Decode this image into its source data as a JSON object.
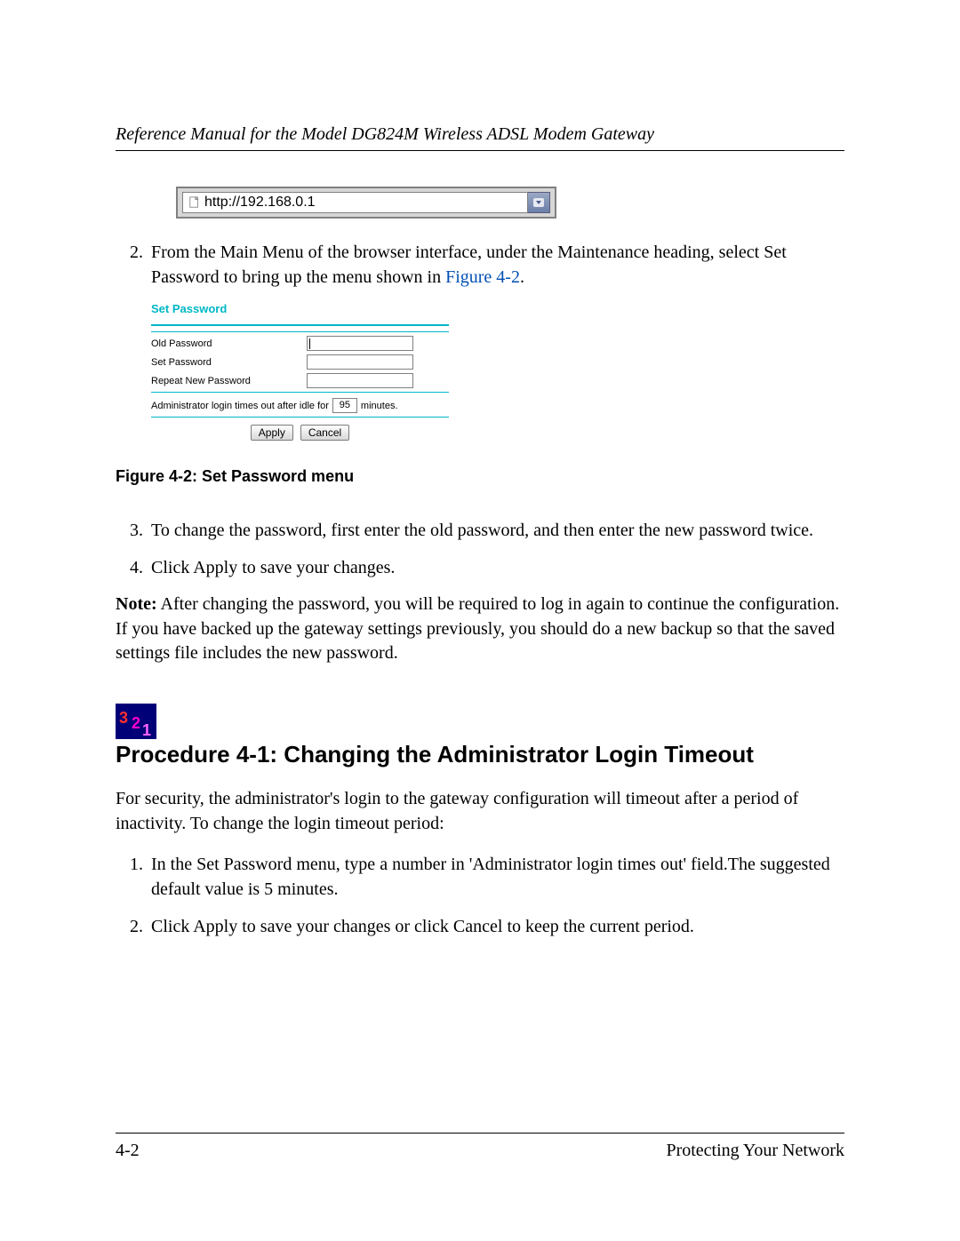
{
  "header": {
    "running_title": "Reference Manual for the Model DG824M Wireless ADSL Modem Gateway"
  },
  "address_bar": {
    "url": "http://192.168.0.1"
  },
  "step2": {
    "text_a": "From the Main Menu of the browser interface, under the Maintenance heading, select Set Password to bring up the menu shown in ",
    "link": "Figure 4-2",
    "text_b": "."
  },
  "set_password_panel": {
    "title": "Set Password",
    "labels": {
      "old": "Old Password",
      "set": "Set Password",
      "repeat": "Repeat New Password"
    },
    "timeout_prefix": "Administrator login times out after idle for",
    "timeout_value": "95",
    "timeout_suffix": "minutes.",
    "apply": "Apply",
    "cancel": "Cancel"
  },
  "figure_caption": "Figure 4-2: Set Password menu",
  "step3": "To change the password, first enter the old password, and then enter the new password twice.",
  "step4": "Click Apply to save your changes.",
  "note": {
    "label": "Note:",
    "body": " After changing the password, you will be required to log in again to continue the configuration. If you have backed up the gateway settings previously, you should do a new backup so that the saved settings file includes the new password."
  },
  "procedure": {
    "heading": "Procedure 4-1:  Changing the Administrator Login Timeout",
    "intro_a": "For security, the administrator's login to the ",
    "intro_gw": "gateway",
    "intro_b": " configuration will timeout after a period of inactivity. To change the login timeout period:",
    "step1": "In the Set Password menu, type a number in 'Administrator login times out' field.The suggested default value is 5 minutes.",
    "step2": "Click Apply to save your changes or click Cancel to keep the current period."
  },
  "footer": {
    "page": "4-2",
    "section": "Protecting Your Network"
  }
}
